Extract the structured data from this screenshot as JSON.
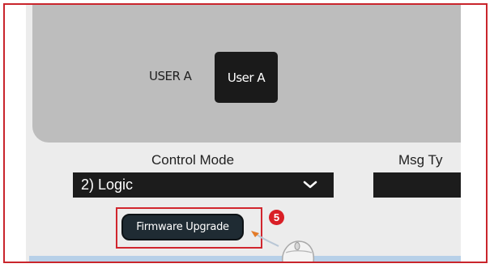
{
  "user_section": {
    "user_label": "USER A",
    "user_button": "User A"
  },
  "control_mode": {
    "label": "Control Mode",
    "selected_value": "2) Logic"
  },
  "message_type": {
    "label": "Msg Ty"
  },
  "firmware": {
    "button_label": "Firmware Upgrade",
    "step_number": "5"
  },
  "colors": {
    "highlight": "#d1262e",
    "frame": "#c9252c",
    "panel": "#bdbdbd",
    "button_dark": "#1a1a1a",
    "bottom_band": "#b7d0e8"
  },
  "icons": [
    "chevron-down-icon",
    "pointer-arrow-icon",
    "mouse-icon"
  ]
}
